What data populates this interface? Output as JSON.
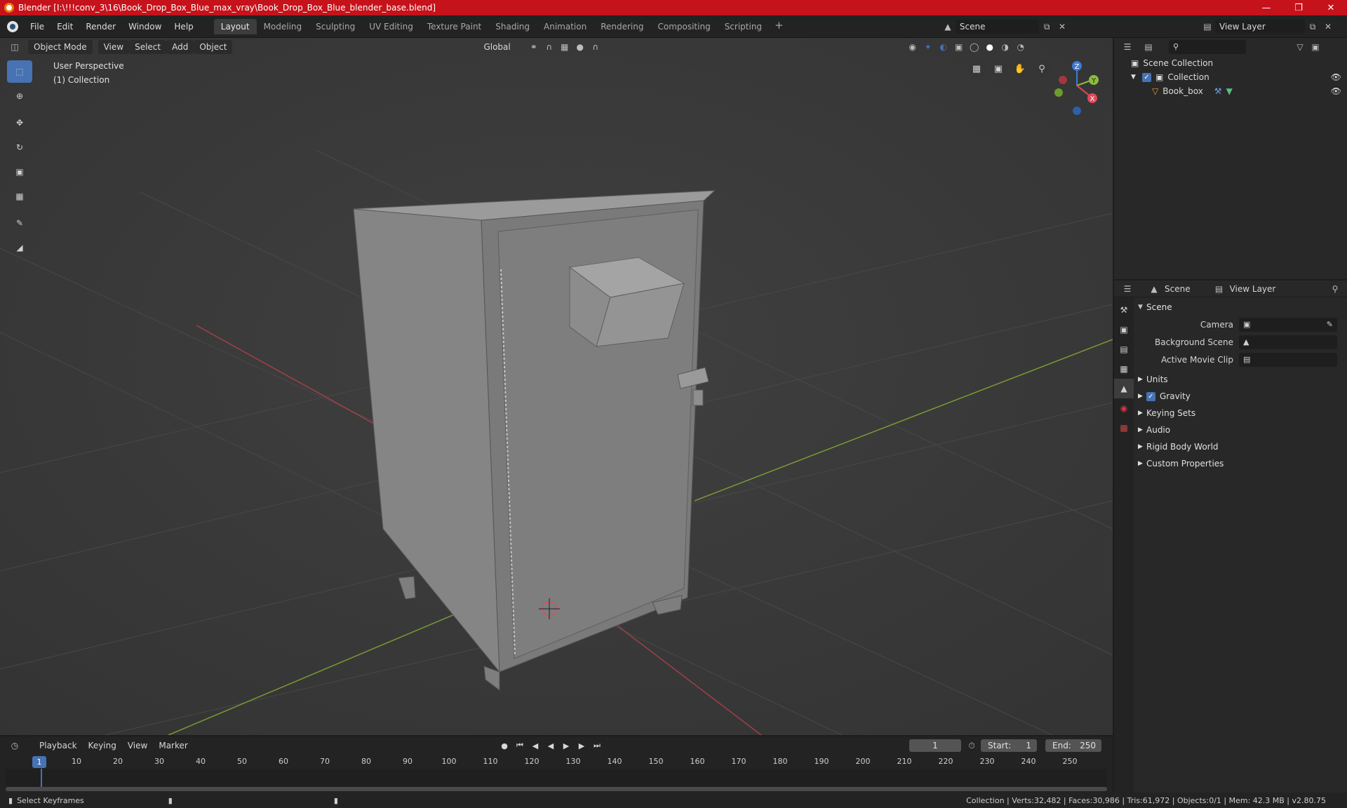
{
  "window": {
    "title": "Blender [I:\\!!!conv_3\\16\\Book_Drop_Box_Blue_max_vray\\Book_Drop_Box_Blue_blender_base.blend]",
    "min_label": "—",
    "max_label": "❐",
    "close_label": "✕"
  },
  "menu": {
    "file": "File",
    "edit": "Edit",
    "render": "Render",
    "window": "Window",
    "help": "Help"
  },
  "workspaces": [
    "Layout",
    "Modeling",
    "Sculpting",
    "UV Editing",
    "Texture Paint",
    "Shading",
    "Animation",
    "Rendering",
    "Compositing",
    "Scripting"
  ],
  "workspace_add": "+",
  "scene_selector": {
    "value": "Scene"
  },
  "view_layer_selector": {
    "value": "View Layer"
  },
  "viewport": {
    "mode": "Object Mode",
    "menus": {
      "view": "View",
      "select": "Select",
      "add": "Add",
      "object": "Object"
    },
    "orientation": "Global",
    "info_line1": "User Perspective",
    "info_line2": "(1) Collection",
    "gizmo": {
      "x": "X",
      "y": "Y",
      "z": "Z"
    }
  },
  "timeline": {
    "menus": {
      "playback": "Playback",
      "keying": "Keying",
      "view": "View",
      "marker": "Marker"
    },
    "current_frame": "1",
    "start_label": "Start:",
    "start_value": "1",
    "end_label": "End:",
    "end_value": "250",
    "ruler_current": "1",
    "ruler_ticks": [
      "10",
      "20",
      "30",
      "40",
      "50",
      "60",
      "70",
      "80",
      "90",
      "100",
      "110",
      "120",
      "130",
      "140",
      "150",
      "160",
      "170",
      "180",
      "190",
      "200",
      "210",
      "220",
      "230",
      "240",
      "250"
    ]
  },
  "outliner": {
    "root": "Scene Collection",
    "collection": "Collection",
    "object": "Book_box"
  },
  "properties": {
    "header_scene": "Scene",
    "header_view_layer": "View Layer",
    "panel_title": "Scene",
    "camera_label": "Camera",
    "background_scene_label": "Background Scene",
    "active_movie_clip_label": "Active Movie Clip",
    "subpanels": {
      "units": "Units",
      "gravity": "Gravity",
      "keying_sets": "Keying Sets",
      "audio": "Audio",
      "rigid_body_world": "Rigid Body World",
      "custom_properties": "Custom Properties"
    },
    "gravity_checked": true
  },
  "status": {
    "left": "Select Keyframes",
    "right": "Collection | Verts:32,482 | Faces:30,986 | Tris:61,972 | Objects:0/1 | Mem: 42.3 MB | v2.80.75"
  },
  "colors": {
    "accent": "#4772b3",
    "titlebar": "#c6121a",
    "x_axis": "#e04a5a",
    "y_axis": "#8cbc3a",
    "z_axis": "#3d7bd6"
  }
}
